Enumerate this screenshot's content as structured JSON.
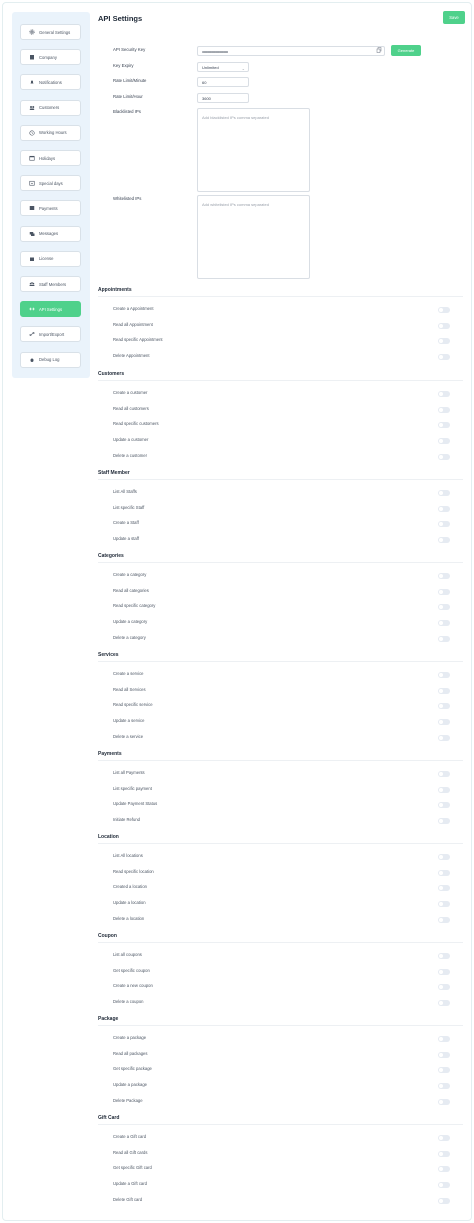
{
  "sidebar": {
    "items": [
      {
        "label": "General Settings",
        "icon": "gear-icon"
      },
      {
        "label": "Company",
        "icon": "building-icon"
      },
      {
        "label": "Notifications",
        "icon": "bell-icon"
      },
      {
        "label": "Customers",
        "icon": "users-icon"
      },
      {
        "label": "Working Hours",
        "icon": "clock-icon"
      },
      {
        "label": "Holidays",
        "icon": "calendar-icon"
      },
      {
        "label": "Special days",
        "icon": "calendar-star-icon"
      },
      {
        "label": "Payments",
        "icon": "card-icon"
      },
      {
        "label": "Messages",
        "icon": "chat-icon"
      },
      {
        "label": "License",
        "icon": "license-icon"
      },
      {
        "label": "Staff Members",
        "icon": "team-icon"
      },
      {
        "label": "API Settings",
        "icon": "api-icon",
        "active": true
      },
      {
        "label": "Import/Export",
        "icon": "transfer-icon"
      },
      {
        "label": "Debug Log",
        "icon": "bug-icon"
      }
    ]
  },
  "header": {
    "title": "API Settings",
    "save_label": "Save"
  },
  "form": {
    "security_key": {
      "label": "API Security Key",
      "value": "••••••••••••••••••••••••••••••••"
    },
    "generate_label": "Generate",
    "key_expiry": {
      "label": "Key Expiry",
      "value": "Unlimited"
    },
    "rate_minute": {
      "label": "Rate Limit/Minute",
      "value": "60"
    },
    "rate_hour": {
      "label": "Rate Limit/Hour",
      "value": "3600"
    },
    "blacklist": {
      "label": "Blacklisted IPs",
      "placeholder": "Add blacklisted IPs comma separated"
    },
    "whitelist": {
      "label": "Whitelisted IPs",
      "placeholder": "Add whitelisted IPs comma separated"
    }
  },
  "sections": [
    {
      "title": "Appointments",
      "items": [
        "Create a Appointment",
        "Read all Appointment",
        "Read specific Appointment",
        "Delete Appointment"
      ]
    },
    {
      "title": "Customers",
      "items": [
        "Create a customer",
        "Read all customers",
        "Read specific customers",
        "Update a customer",
        "Delete a customer"
      ]
    },
    {
      "title": "Staff Member",
      "items": [
        "List All Staffs",
        "List specific Staff",
        "Create a Staff",
        "Update a staff"
      ]
    },
    {
      "title": "Categories",
      "items": [
        "Create a category",
        "Read all categories",
        "Read specific category",
        "Update a category",
        "Delete a category"
      ]
    },
    {
      "title": "Services",
      "items": [
        "Create a service",
        "Read all Services",
        "Read specific service",
        "Update a service",
        "Delete a service"
      ]
    },
    {
      "title": "Payments",
      "items": [
        "List all Payments",
        "List specific payment",
        "Update Payment Status",
        "Initiate Refund"
      ]
    },
    {
      "title": "Location",
      "items": [
        "List All locations",
        "Read specific location",
        "Created a location",
        "Update a location",
        "Delete a location"
      ]
    },
    {
      "title": "Coupon",
      "items": [
        "List all coupons",
        "Get specific coupon",
        "Create a new coupon",
        "Delete a coupon"
      ]
    },
    {
      "title": "Package",
      "items": [
        "Create a package",
        "Read all packages",
        "Get specific package",
        "Update a package",
        "Delete Package"
      ]
    },
    {
      "title": "Gift Card",
      "items": [
        "Create a Gift card",
        "Read all Gift cards",
        "Get specific Gift card",
        "Update a Gift card",
        "Delete Gift card"
      ]
    }
  ]
}
